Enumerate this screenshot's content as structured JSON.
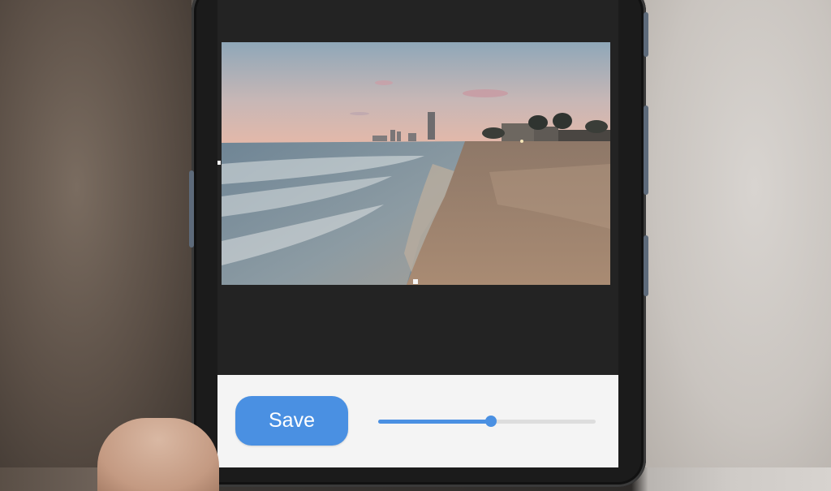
{
  "editor": {
    "photo_description_icon": "beach-photo",
    "save_label": "Save",
    "slider_value": 0.52
  },
  "colors": {
    "accent": "#4a90e2",
    "panel": "#f4f4f4",
    "screen": "#232323"
  }
}
